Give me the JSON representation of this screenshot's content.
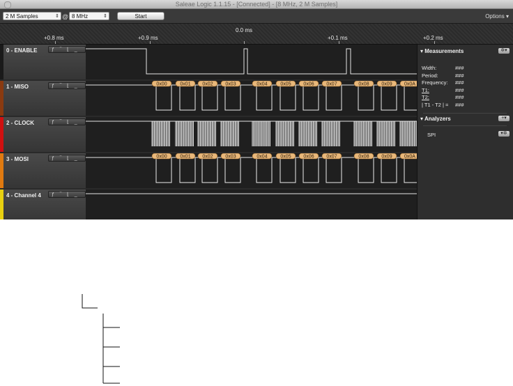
{
  "titlebar": {
    "title": "Saleae Logic 1.1.15 - [Connected] - [8 MHz, 2 M Samples]"
  },
  "toolbar": {
    "samples": "2 M Samples",
    "at": "@",
    "rate": "8 MHz",
    "start": "Start",
    "options": "Options ▾"
  },
  "ruler": {
    "center": "0.0 ms",
    "labels": [
      "+0.8 ms",
      "+0.9 ms",
      "+0.1 ms",
      "+0.2 ms"
    ]
  },
  "channels": [
    {
      "name": "0 - ENABLE",
      "color": "#1a1a1a"
    },
    {
      "name": "1 - MISO",
      "color": "#8a3a10"
    },
    {
      "name": "2 - CLOCK",
      "color": "#d01010"
    },
    {
      "name": "3 - MOSI",
      "color": "#e07a10"
    },
    {
      "name": "4 - Channel 4",
      "color": "#e8d010"
    }
  ],
  "trigger_glyphs": "ƒ ‾ ⌊ _",
  "bytes": [
    "0x00",
    "0x01",
    "0x02",
    "0x03",
    "0x04",
    "0x05",
    "0x06",
    "0x07",
    "0x08",
    "0x09",
    "0x0A"
  ],
  "measurements": {
    "title": "Measurements",
    "rows": [
      {
        "k": "Width:",
        "v": "###"
      },
      {
        "k": "Period:",
        "v": "###"
      },
      {
        "k": "Frequency:",
        "v": "###"
      },
      {
        "k": "T1:",
        "v": "###"
      },
      {
        "k": "T2:",
        "v": "###"
      },
      {
        "k": "| T1 - T2 | =",
        "v": "###"
      }
    ]
  },
  "analyzers": {
    "title": "Analyzers",
    "add": "+▾",
    "items": [
      {
        "name": "SPI"
      }
    ]
  },
  "icons": {
    "gear": "gear-icon",
    "triangle": "disclosure-triangle-icon"
  }
}
